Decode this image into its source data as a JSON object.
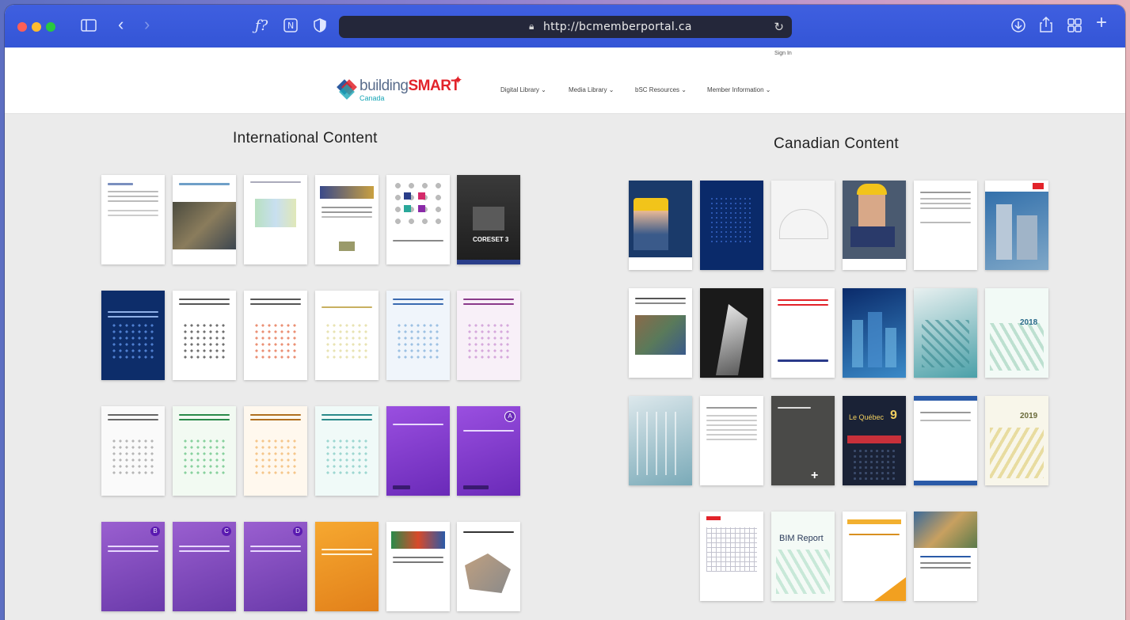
{
  "browser": {
    "url": "http://bcmemberportal.ca",
    "sign_in": "Sign In"
  },
  "site": {
    "logo_prefix": "building",
    "logo_accent": "SMART",
    "logo_sub": "Canada",
    "nav": [
      {
        "label": "Digital Library ⌄"
      },
      {
        "label": "Media Library ⌄"
      },
      {
        "label": "bSC Resources ⌄"
      },
      {
        "label": "Member Information ⌄"
      }
    ]
  },
  "sections": {
    "international_title": "International Content",
    "canadian_title": "Canadian Content"
  },
  "thumb_labels": {
    "coreset": "CORESET 3",
    "badge_a": "A",
    "badge_b": "B",
    "badge_c": "C",
    "badge_d": "D",
    "bim_report": "BIM Report",
    "year_2018": "2018",
    "year_2019": "2019",
    "quebec": "Le Québec",
    "quebec_num": "9"
  },
  "colors": {
    "toolbar": "#3455d6",
    "traffic_red": "#ff5f57",
    "traffic_yellow": "#febc2e",
    "traffic_green": "#28c840",
    "brand_red": "#e2232a",
    "brand_teal": "#19a6b6",
    "purple_doc": "#7a3fc4",
    "navy_doc": "#0d2d6a"
  }
}
